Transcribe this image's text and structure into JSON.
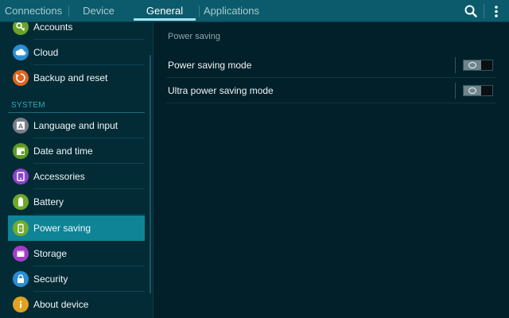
{
  "tabs": [
    {
      "label": "Connections",
      "active": false
    },
    {
      "label": "Device",
      "active": false
    },
    {
      "label": "General",
      "active": true
    },
    {
      "label": "Applications",
      "active": false
    }
  ],
  "actions": {
    "search_icon": "search-icon",
    "more_icon": "more-vert-icon"
  },
  "sidebar": {
    "items_top": [
      {
        "label": "Accounts",
        "icon": "key-icon",
        "color": "#6aa22a"
      },
      {
        "label": "Cloud",
        "icon": "cloud-icon",
        "color": "#2a8ed6"
      },
      {
        "label": "Backup and reset",
        "icon": "backup-icon",
        "color": "#e0651f"
      }
    ],
    "section_header": "SYSTEM",
    "items_system": [
      {
        "label": "Language and input",
        "icon": "language-icon",
        "color": "#7a7f8a"
      },
      {
        "label": "Date and time",
        "icon": "calendar-icon",
        "color": "#5e9a22"
      },
      {
        "label": "Accessories",
        "icon": "accessories-icon",
        "color": "#8b45c9"
      },
      {
        "label": "Battery",
        "icon": "battery-icon",
        "color": "#6fa82a"
      },
      {
        "label": "Power saving",
        "icon": "power-saving-icon",
        "color": "#72ac2c",
        "selected": true
      },
      {
        "label": "Storage",
        "icon": "storage-icon",
        "color": "#a23fc4"
      },
      {
        "label": "Security",
        "icon": "lock-icon",
        "color": "#2a8ed6"
      },
      {
        "label": "About device",
        "icon": "info-icon",
        "color": "#e0a21f"
      }
    ]
  },
  "content": {
    "section_title": "Power saving",
    "rows": [
      {
        "label": "Power saving mode",
        "toggle": "off"
      },
      {
        "label": "Ultra power saving mode",
        "toggle": "off"
      }
    ]
  }
}
